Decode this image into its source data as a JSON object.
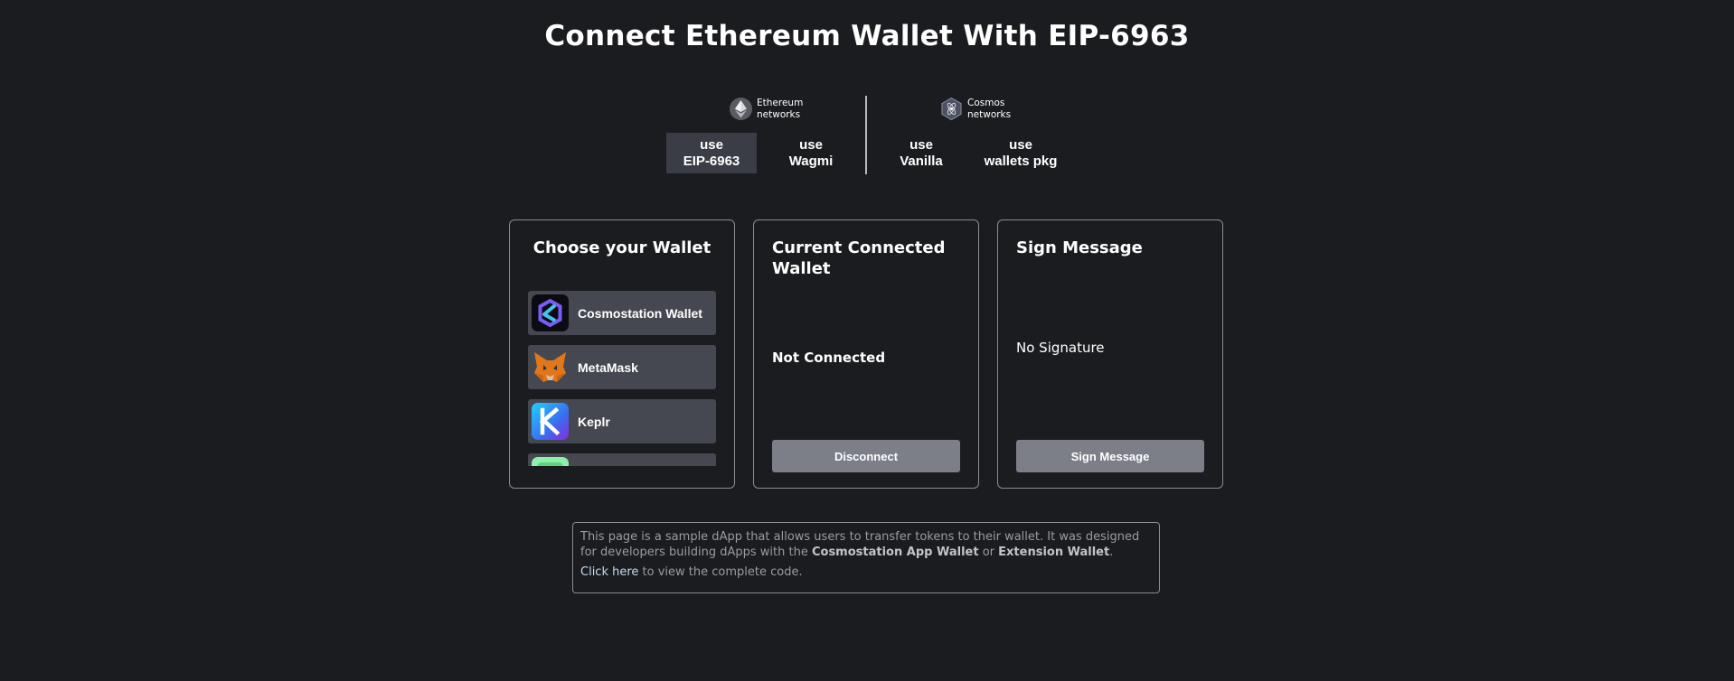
{
  "page": {
    "title": "Connect Ethereum Wallet With EIP-6963"
  },
  "networks": {
    "ethereum": {
      "label_line1": "Ethereum",
      "label_line2": "networks"
    },
    "cosmos": {
      "label_line1": "Cosmos",
      "label_line2": "networks"
    }
  },
  "tabs": [
    {
      "line1": "use",
      "line2": "EIP-6963",
      "active": true
    },
    {
      "line1": "use",
      "line2": "Wagmi",
      "active": false
    },
    {
      "line1": "use",
      "line2": "Vanilla",
      "active": false
    },
    {
      "line1": "use",
      "line2": "wallets pkg",
      "active": false
    }
  ],
  "wallet_card": {
    "title": "Choose your Wallet",
    "wallets": [
      {
        "name": "Cosmostation Wallet",
        "icon": "cosmostation-logo-icon"
      },
      {
        "name": "MetaMask",
        "icon": "metamask-fox-icon"
      },
      {
        "name": "Keplr",
        "icon": "keplr-k-icon"
      },
      {
        "name": "",
        "icon": "green-wallet-logo-icon"
      }
    ]
  },
  "connected_card": {
    "title": "Current Connected Wallet",
    "status": "Not Connected",
    "button": "Disconnect"
  },
  "sign_card": {
    "title": "Sign Message",
    "status": "No Signature",
    "button": "Sign Message"
  },
  "info": {
    "text_before": "This page is a sample dApp that allows users to transfer tokens to their wallet. It was designed for developers building dApps with the",
    "app_wallet": "Cosmostation App Wallet",
    "or": "or",
    "extension_wallet": "Extension Wallet",
    "period": ".",
    "link": "Click here",
    "text_after": "to view the complete code."
  },
  "colors": {
    "background": "#1b1c20",
    "tab_active": "#3a3d45",
    "wallet_item": "#454850",
    "button": "#7c7f88",
    "border": "#8a8c93"
  }
}
